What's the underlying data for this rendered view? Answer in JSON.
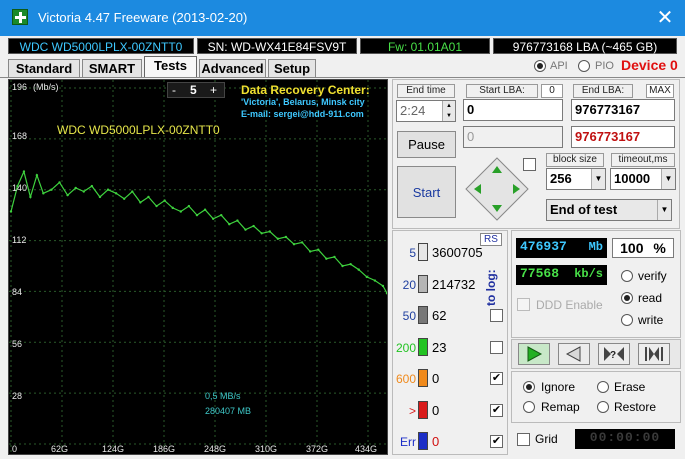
{
  "window": {
    "title": "Victoria 4.47  Freeware (2013-02-20)",
    "close_glyph": "✕"
  },
  "info": {
    "model": "WDC WD5000LPLX-00ZNTT0",
    "serial": "SN: WD-WX41E84FSV9T",
    "firmware": "Fw: 01.01A01",
    "capacity": "976773168 LBA (~465 GB)"
  },
  "tabs": [
    {
      "label": "Standard"
    },
    {
      "label": "SMART"
    },
    {
      "label": "Tests"
    },
    {
      "label": "Advanced"
    },
    {
      "label": "Setup"
    }
  ],
  "mode": {
    "api_label": "API",
    "pio_label": "PIO",
    "device_label": "Device 0"
  },
  "graph": {
    "y_unit": "(Mb/s)",
    "y_ticks": [
      "196",
      "168",
      "140",
      "112",
      "84",
      "56",
      "28"
    ],
    "x_ticks": [
      "0",
      "62G",
      "124G",
      "186G",
      "248G",
      "310G",
      "372G",
      "434G"
    ],
    "drive_label": "WDC WD5000LPLX-00ZNTT0",
    "zoom_minus": "-",
    "zoom_value": "5",
    "zoom_plus": "+",
    "drc_title": "Data Recovery Center:",
    "drc_line1": "'Victoria', Belarus, Minsk city",
    "drc_line2": "E-mail: sergei@hdd-911.com",
    "speed_readout": "0,5 MB/s",
    "position_readout": "280407 MB",
    "colors": {
      "trace": "#3ed23e",
      "bg": "#000000",
      "grid": "#2a5a2a"
    }
  },
  "chart_data": {
    "type": "line",
    "x_unit": "GB",
    "y_unit": "Mb/s",
    "ylim": [
      0,
      196
    ],
    "xlim": [
      0,
      465
    ],
    "x": [
      0,
      8,
      16,
      24,
      32,
      40,
      50,
      60,
      70,
      80,
      90,
      100,
      110,
      120,
      130,
      140,
      150,
      160,
      170,
      180,
      190,
      200,
      210,
      220,
      230,
      240,
      250,
      260,
      270,
      280,
      290,
      300,
      310,
      320,
      330,
      340,
      350,
      360,
      370,
      380,
      390,
      400,
      410,
      420,
      430,
      440,
      450,
      460,
      465
    ],
    "y": [
      128,
      142,
      150,
      136,
      148,
      138,
      140,
      144,
      137,
      141,
      139,
      142,
      136,
      140,
      138,
      135,
      139,
      133,
      136,
      131,
      134,
      130,
      128,
      131,
      126,
      129,
      124,
      126,
      121,
      123,
      118,
      120,
      116,
      117,
      113,
      114,
      110,
      111,
      106,
      107,
      102,
      103,
      98,
      99,
      96,
      92,
      90,
      87,
      83
    ],
    "grid": true
  },
  "start": {
    "end_time_label": "End time",
    "end_time_value": "2:24",
    "start_lba_label": "Start LBA:",
    "start_lba_zero": "0",
    "end_lba_label": "End LBA:",
    "max_label": "MAX",
    "start_lba_value": "0",
    "end_lba_value": "976773167",
    "start_lba_value2": "0",
    "end_lba_value2": "976773167",
    "pause_label": "Pause",
    "start_label": "Start",
    "block_size_label": "block size",
    "block_size_value": "256",
    "timeout_label": "timeout,ms",
    "timeout_value": "10000",
    "action_value": "End of test"
  },
  "legend": {
    "rs_label": "RS",
    "to_log_label": "to log:",
    "rows": [
      {
        "threshold": "5",
        "count": "3600705",
        "color": "#e6e6e6"
      },
      {
        "threshold": "20",
        "count": "214732",
        "color": "#b5b5b5"
      },
      {
        "threshold": "50",
        "count": "62",
        "color": "#777777"
      },
      {
        "threshold": "200",
        "count": "23",
        "color": "#22c322"
      },
      {
        "threshold": "600",
        "count": "0",
        "color": "#f08a1c"
      },
      {
        "threshold": ">",
        "count": "0",
        "color": "#d91b1b"
      },
      {
        "threshold": "Err",
        "count": "0",
        "color": "#1c2ec7"
      }
    ],
    "to_log_checked": [
      false,
      false,
      false,
      false,
      true,
      true,
      true
    ]
  },
  "status": {
    "mb_value": "476937",
    "mb_unit": "Mb",
    "percent": "100",
    "percent_unit": "%",
    "speed_value": "77568",
    "speed_unit": "kb/s",
    "ddd_label": "DDD Enable",
    "verify_label": "verify",
    "read_label": "read",
    "write_label": "write",
    "mode_selected": "read",
    "ignore_label": "Ignore",
    "erase_label": "Erase",
    "remap_label": "Remap",
    "restore_label": "Restore",
    "repair_selected": "Ignore",
    "grid_label": "Grid",
    "timer": "00:00:00"
  }
}
